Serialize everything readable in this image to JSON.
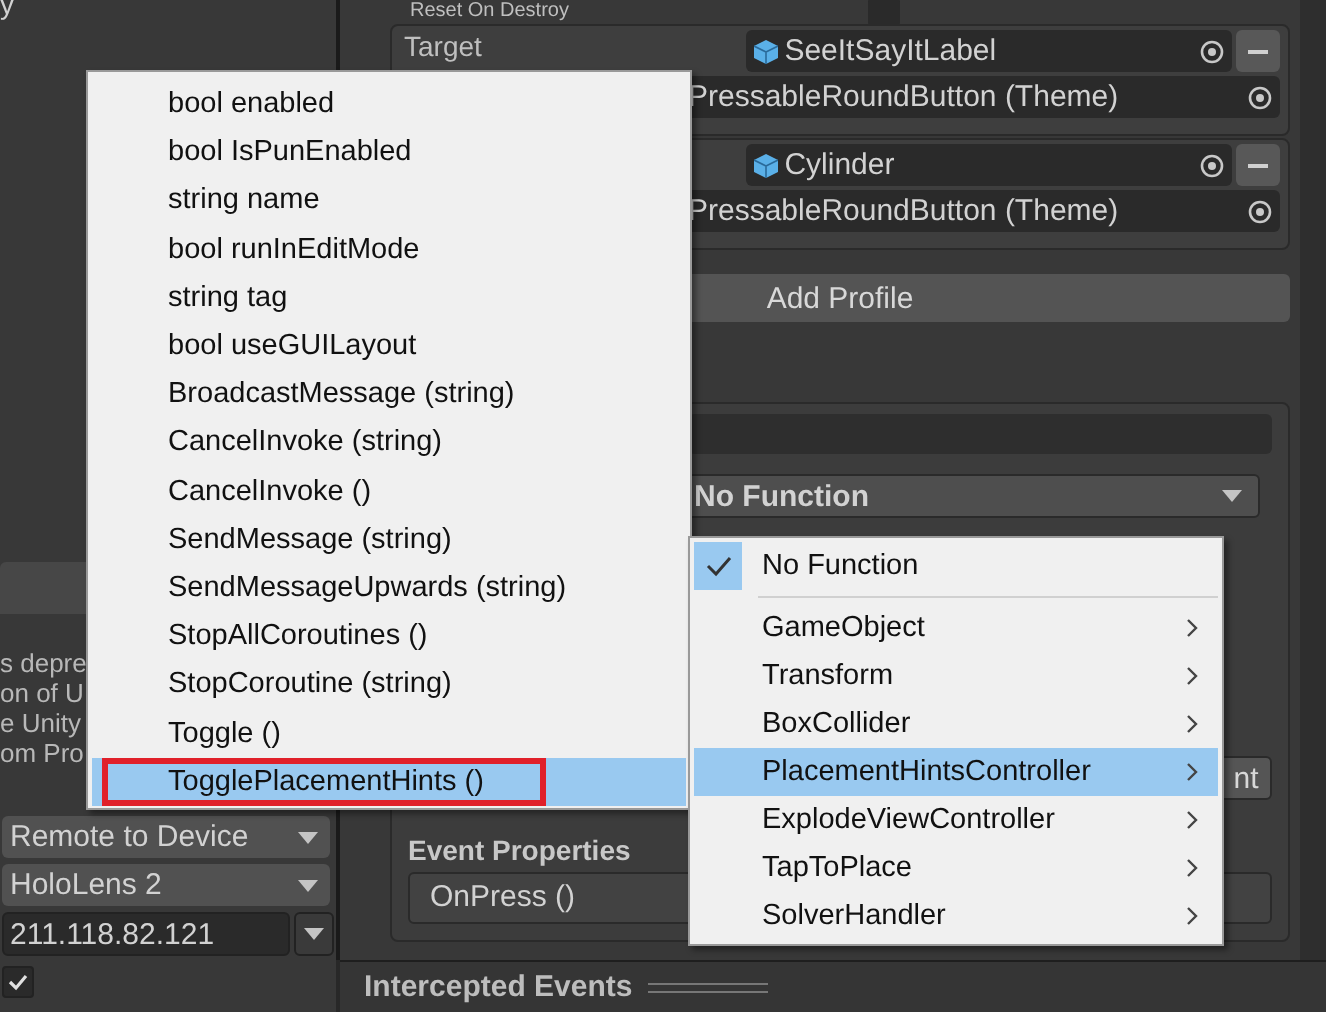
{
  "left_panel": {
    "heading_fragment": "y",
    "notice_lines": [
      "s depre",
      "on of U",
      "e Unity",
      "om Pro"
    ],
    "dropdowns": [
      {
        "value": "Remote to Device"
      },
      {
        "value": "HoloLens 2"
      }
    ],
    "address_field": {
      "value": "211.118.82.121"
    },
    "checkbox": {
      "checked": true
    }
  },
  "inspector": {
    "reset_on_destroy": {
      "label": "Reset On Destroy",
      "checked": false
    },
    "profiles": [
      {
        "label": "Target",
        "target": "SeeItSayItLabel",
        "theme": "PressableRoundButton (Theme)"
      },
      {
        "target": "Cylinder",
        "theme": "PressableRoundButton (Theme)"
      }
    ],
    "add_profile_button": "Add Profile",
    "function_dropdown": "No Function",
    "partial_button": "nt",
    "event_properties_heading": "Event Properties",
    "event_field": "OnPress ()",
    "bottom_bar": "Intercepted Events"
  },
  "method_menu": {
    "items": [
      {
        "label": "bool enabled",
        "selected": false,
        "outlined": false
      },
      {
        "label": "bool IsPunEnabled",
        "selected": false,
        "outlined": false
      },
      {
        "label": "string name",
        "selected": false,
        "outlined": false
      },
      {
        "label": "bool runInEditMode",
        "selected": false,
        "outlined": false
      },
      {
        "label": "string tag",
        "selected": false,
        "outlined": false
      },
      {
        "label": "bool useGUILayout",
        "selected": false,
        "outlined": false
      },
      {
        "label": "BroadcastMessage (string)",
        "selected": false,
        "outlined": false
      },
      {
        "label": "CancelInvoke (string)",
        "selected": false,
        "outlined": false
      },
      {
        "label": "CancelInvoke ()",
        "selected": false,
        "outlined": false
      },
      {
        "label": "SendMessage (string)",
        "selected": false,
        "outlined": false
      },
      {
        "label": "SendMessageUpwards (string)",
        "selected": false,
        "outlined": false
      },
      {
        "label": "StopAllCoroutines ()",
        "selected": false,
        "outlined": false
      },
      {
        "label": "StopCoroutine (string)",
        "selected": false,
        "outlined": false
      },
      {
        "label": "Toggle ()",
        "selected": false,
        "outlined": false
      },
      {
        "label": "TogglePlacementHints ()",
        "selected": true,
        "outlined": true
      }
    ]
  },
  "component_menu": {
    "items": [
      {
        "kind": "option",
        "label": "No Function",
        "checked": true
      },
      {
        "kind": "separator"
      },
      {
        "kind": "submenu",
        "label": "GameObject",
        "selected": false
      },
      {
        "kind": "submenu",
        "label": "Transform",
        "selected": false
      },
      {
        "kind": "submenu",
        "label": "BoxCollider",
        "selected": false
      },
      {
        "kind": "submenu",
        "label": "PlacementHintsController",
        "selected": true
      },
      {
        "kind": "submenu",
        "label": "ExplodeViewController",
        "selected": false
      },
      {
        "kind": "submenu",
        "label": "TapToPlace",
        "selected": false
      },
      {
        "kind": "submenu",
        "label": "SolverHandler",
        "selected": false
      }
    ]
  }
}
